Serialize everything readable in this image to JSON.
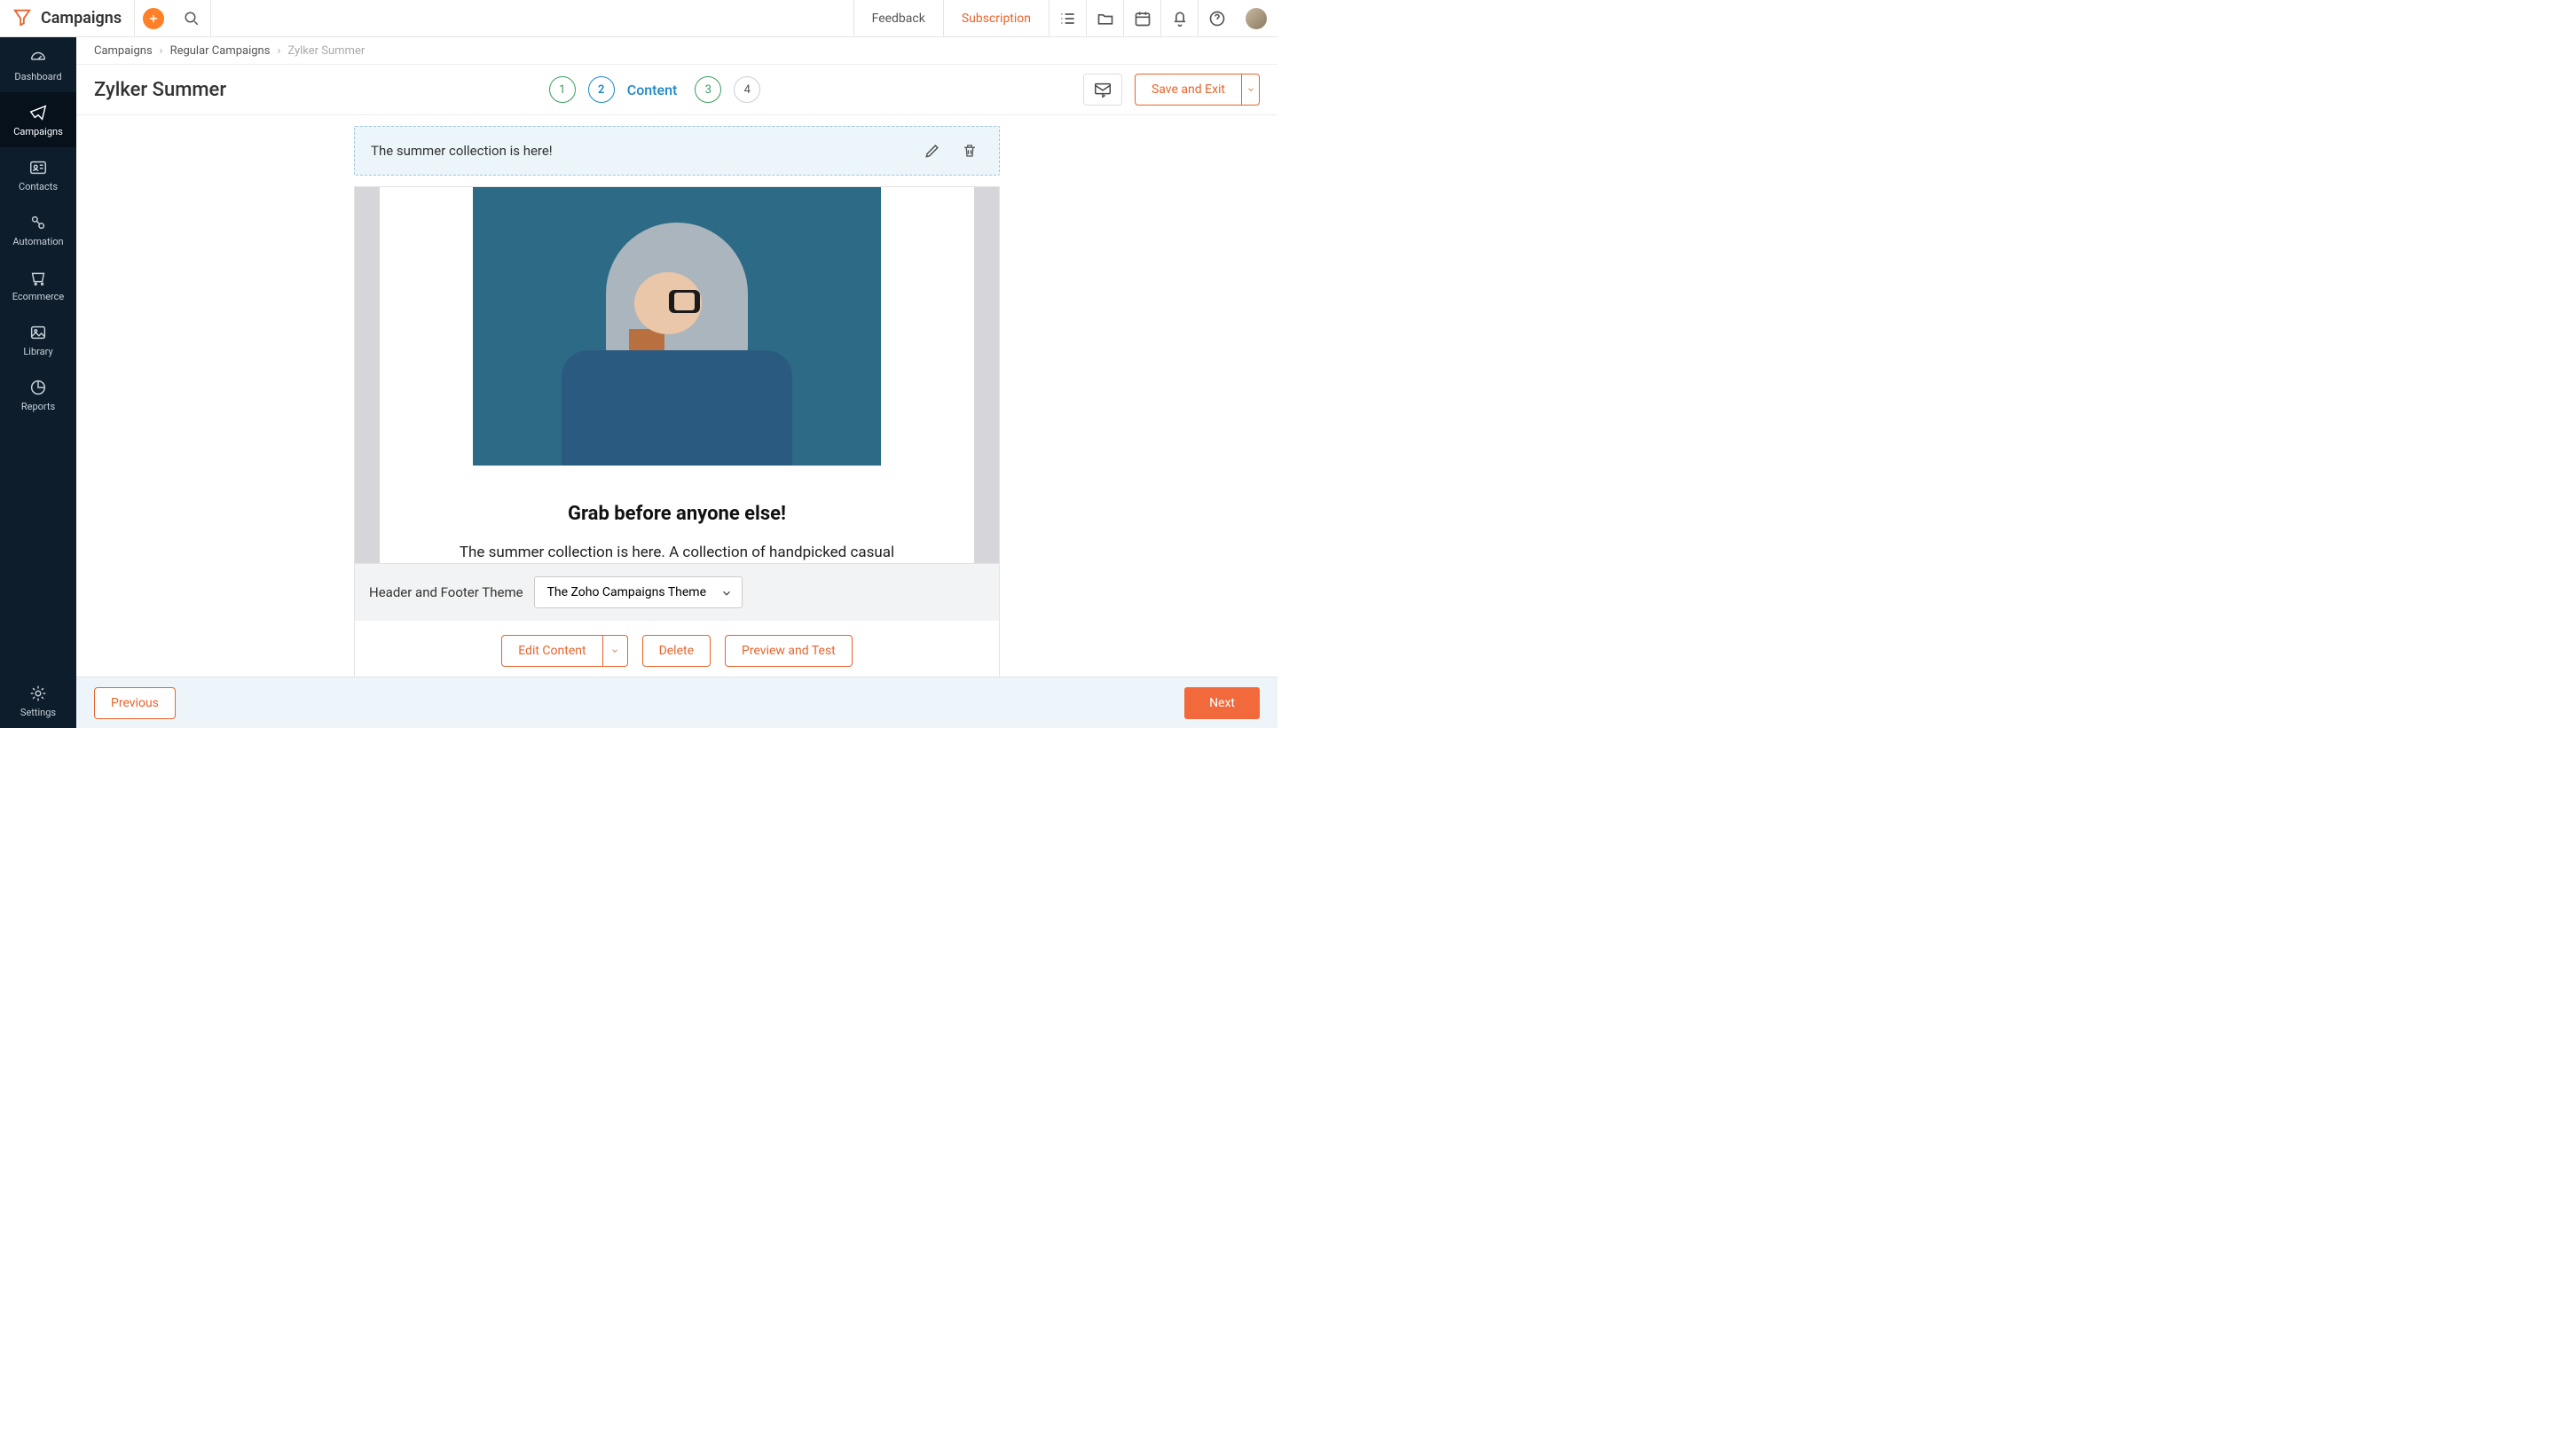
{
  "brand": "Campaigns",
  "header": {
    "feedback": "Feedback",
    "subscription": "Subscription"
  },
  "sidebar": {
    "items": [
      {
        "label": "Dashboard"
      },
      {
        "label": "Campaigns"
      },
      {
        "label": "Contacts"
      },
      {
        "label": "Automation"
      },
      {
        "label": "Ecommerce"
      },
      {
        "label": "Library"
      },
      {
        "label": "Reports"
      }
    ],
    "settings": "Settings"
  },
  "breadcrumbs": {
    "a": "Campaigns",
    "b": "Regular Campaigns",
    "c": "Zylker Summer"
  },
  "campaign": {
    "title": "Zylker Summer",
    "steps": [
      "1",
      "2",
      "3",
      "4"
    ],
    "stepLabel": "Content",
    "saveExit": "Save and Exit"
  },
  "subject": "The summer collection is here!",
  "preview": {
    "headline": "Grab before anyone else!",
    "body": "The summer collection is here. A collection of handpicked casual"
  },
  "hf": {
    "label": "Header and Footer Theme",
    "value": "The Zoho Campaigns Theme"
  },
  "actions": {
    "edit": "Edit Content",
    "delete": "Delete",
    "preview": "Preview and Test"
  },
  "footer": {
    "prev": "Previous",
    "next": "Next"
  }
}
